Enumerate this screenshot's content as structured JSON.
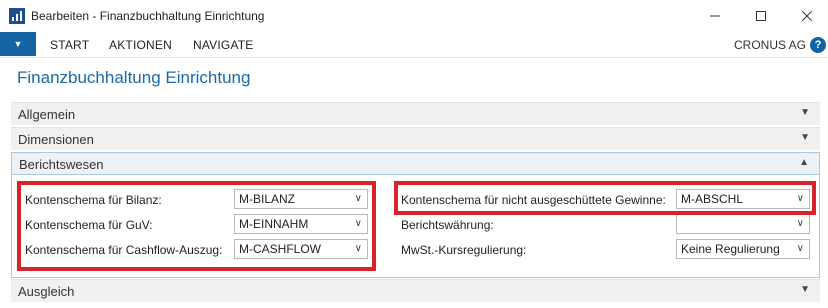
{
  "window": {
    "title": "Bearbeiten - Finanzbuchhaltung Einrichtung",
    "minimize_icon": "minimize-icon",
    "maximize_icon": "maximize-icon",
    "close_icon": "close-icon"
  },
  "ribbon": {
    "tabs": [
      "START",
      "AKTIONEN",
      "NAVIGATE"
    ],
    "company": "CRONUS AG",
    "help": "?"
  },
  "page": {
    "title": "Finanzbuchhaltung Einrichtung"
  },
  "fasttabs": {
    "allgemein": "Allgemein",
    "dimensionen": "Dimensionen",
    "berichtswesen": "Berichtswesen",
    "ausgleich": "Ausgleich"
  },
  "fields": {
    "bilanz": {
      "label": "Kontenschema für Bilanz:",
      "value": "M-BILANZ"
    },
    "guv": {
      "label": "Kontenschema für GuV:",
      "value": "M-EINNAHM"
    },
    "cashflow": {
      "label": "Kontenschema für Cashflow-Auszug:",
      "value": "M-CASHFLOW"
    },
    "gewinne": {
      "label": "Kontenschema für nicht ausgeschüttete Gewinne:",
      "value": "M-ABSCHL"
    },
    "waehrung": {
      "label": "Berichtswährung:",
      "value": ""
    },
    "kurs": {
      "label": "MwSt.-Kursregulierung:",
      "value": "Keine Regulierung"
    }
  },
  "colors": {
    "accent": "#1464a5",
    "title_blue": "#1b6aa8",
    "highlight_red": "#d9232b"
  }
}
